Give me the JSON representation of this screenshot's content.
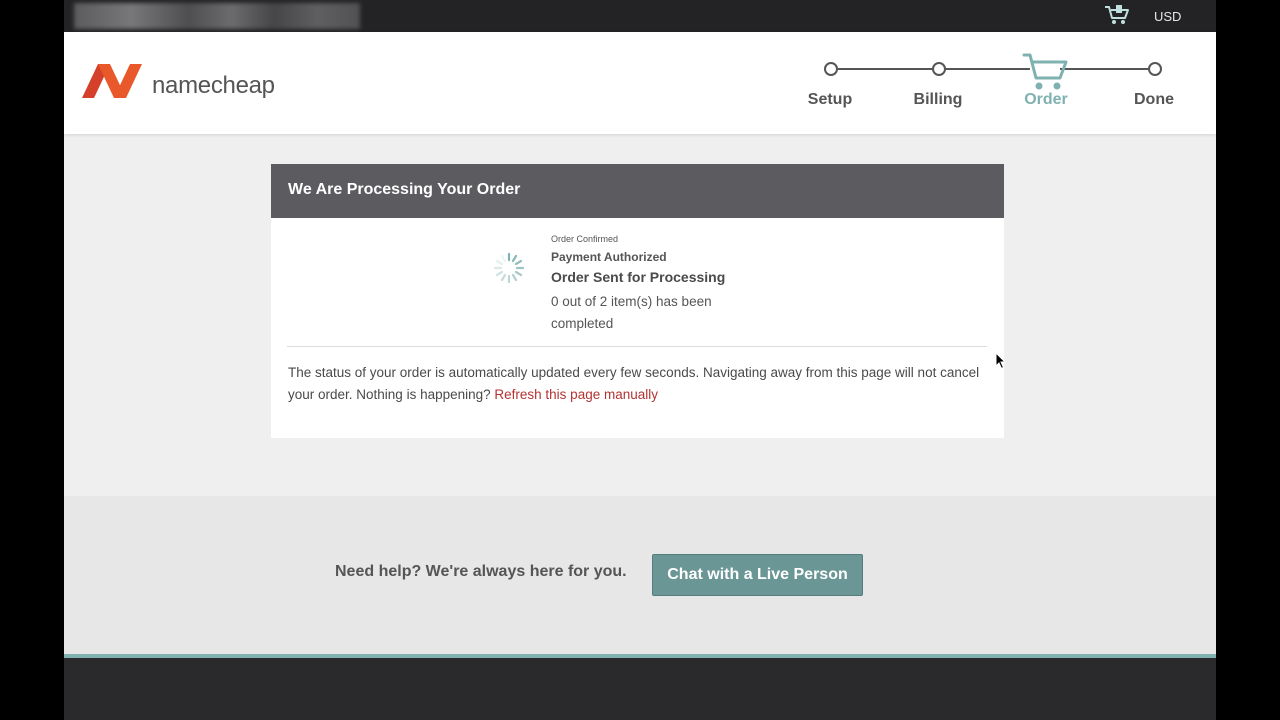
{
  "topbar": {
    "currency": "USD",
    "icons": {
      "cart": "cart-icon"
    }
  },
  "brand": {
    "name": "namecheap",
    "logo": "namecheap-logo",
    "colors": {
      "orange": "#e8582b",
      "red": "#d4402a"
    }
  },
  "steps": [
    {
      "label": "Setup",
      "active": false
    },
    {
      "label": "Billing",
      "active": false
    },
    {
      "label": "Order",
      "active": true
    },
    {
      "label": "Done",
      "active": false
    }
  ],
  "order": {
    "title": "We Are Processing Your Order",
    "status_order_confirmed": "Order Confirmed",
    "status_payment_authorized": "Payment Authorized",
    "status_sent": "Order Sent for Processing",
    "progress_text": "0 out of 2 item(s) has been completed",
    "note": "The status of your order is automatically updated every few seconds. Navigating away from this page will not cancel your order. Nothing is happening?",
    "refresh_link": "Refresh this page manually"
  },
  "help": {
    "text": "Need help? We're always here for you.",
    "chat_button": "Chat with a Live Person"
  },
  "colors": {
    "accent": "#7fb1b0",
    "button": "#6a9696",
    "header_bar": "#5c5b60",
    "link": "#b33333"
  }
}
